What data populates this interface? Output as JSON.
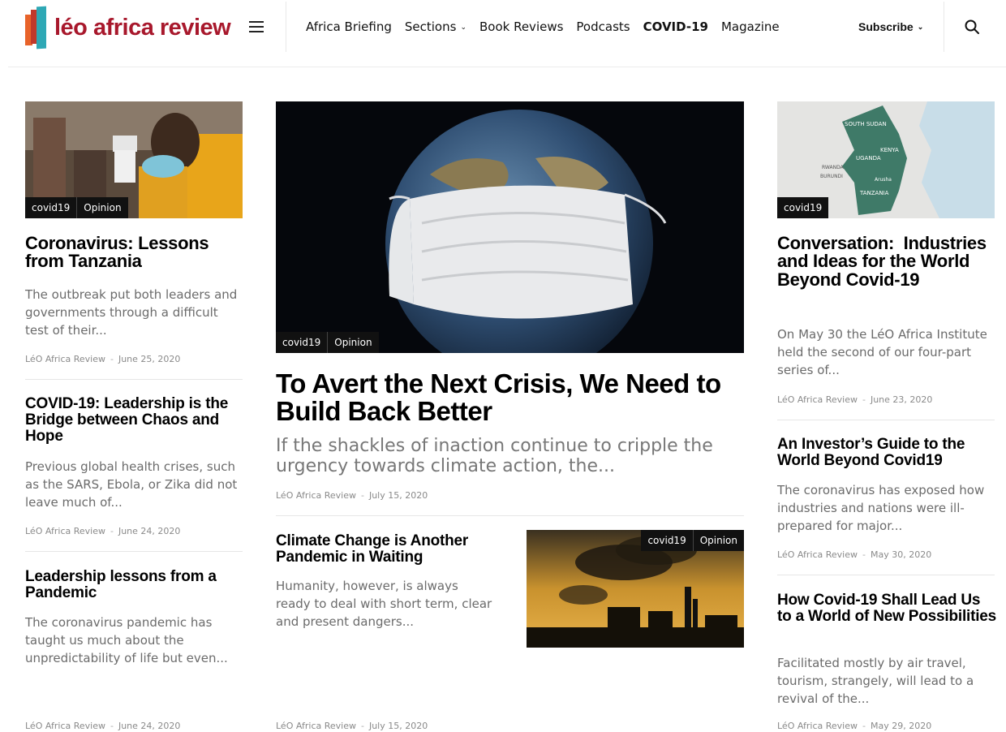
{
  "header": {
    "logo_text": "léo africa review",
    "nav": [
      {
        "label": "Africa Briefing"
      },
      {
        "label": "Sections"
      },
      {
        "label": "Book Reviews"
      },
      {
        "label": "Podcasts"
      },
      {
        "label": "COVID-19"
      },
      {
        "label": "Magazine"
      }
    ],
    "subscribe_label": "Subscribe"
  },
  "colors": {
    "brand": "#a8182c",
    "tag_bg": "#111111",
    "excerpt": "#6b6b6b"
  },
  "left": {
    "feature": {
      "tags": [
        "covid19",
        "Opinion"
      ],
      "title": "Coronavirus: Lessons from Tanzania",
      "excerpt": "The outbreak put both leaders and governments through a difficult test of their...",
      "author": "LéO Africa Review",
      "date": "June 25, 2020"
    },
    "items": [
      {
        "title": "COVID-19: Leadership is the Bridge between Chaos and Hope",
        "excerpt": "Previous global health crises, such as the SARS, Ebola, or Zika did not leave much of...",
        "author": "LéO Africa Review",
        "date": "June 24, 2020"
      },
      {
        "title": "Leadership lessons from a Pandemic",
        "excerpt": "The coronavirus pandemic has taught us much about the unpredictability of life but even...",
        "author": "LéO Africa Review",
        "date": "June 24, 2020"
      }
    ]
  },
  "center": {
    "main": {
      "tags": [
        "covid19",
        "Opinion"
      ],
      "title": "To Avert the Next Crisis, We Need to Build Back Better",
      "excerpt": "If the shackles of inaction continue to cripple the urgency towards climate action, the...",
      "author": "LéO Africa Review",
      "date": "July 15, 2020"
    },
    "secondary": {
      "tags": [
        "covid19",
        "Opinion"
      ],
      "title": "Climate Change is Another Pandemic in Waiting",
      "excerpt": "Humanity, however, is always ready to deal with short term, clear and present dangers...",
      "author": "LéO Africa Review",
      "date": "July 15, 2020"
    }
  },
  "right": {
    "feature": {
      "tags": [
        "covid19"
      ],
      "map_labels": [
        "SOUTH SUDAN",
        "KENYA",
        "UGANDA",
        "RWANDA",
        "BURUNDI",
        "Arusha",
        "TANZANIA"
      ],
      "title": "Conversation:  Industries and Ideas for the World Beyond Covid-19",
      "excerpt": "On May 30 the LéO Africa Institute held the second of our four-part series of...",
      "author": "LéO Africa Review",
      "date": "June 23, 2020"
    },
    "items": [
      {
        "title": "An Investor’s Guide to the World Beyond Covid19",
        "excerpt": "The coronavirus has exposed how industries and nations were ill-prepared for major...",
        "author": "LéO Africa Review",
        "date": "May 30, 2020"
      },
      {
        "title": "How Covid-19 Shall Lead Us to a World of New Possibilities",
        "excerpt": "Facilitated mostly by air travel, tourism, strangely, will lead to a revival of the...",
        "author": "LéO Africa Review",
        "date": "May 29, 2020"
      }
    ]
  }
}
